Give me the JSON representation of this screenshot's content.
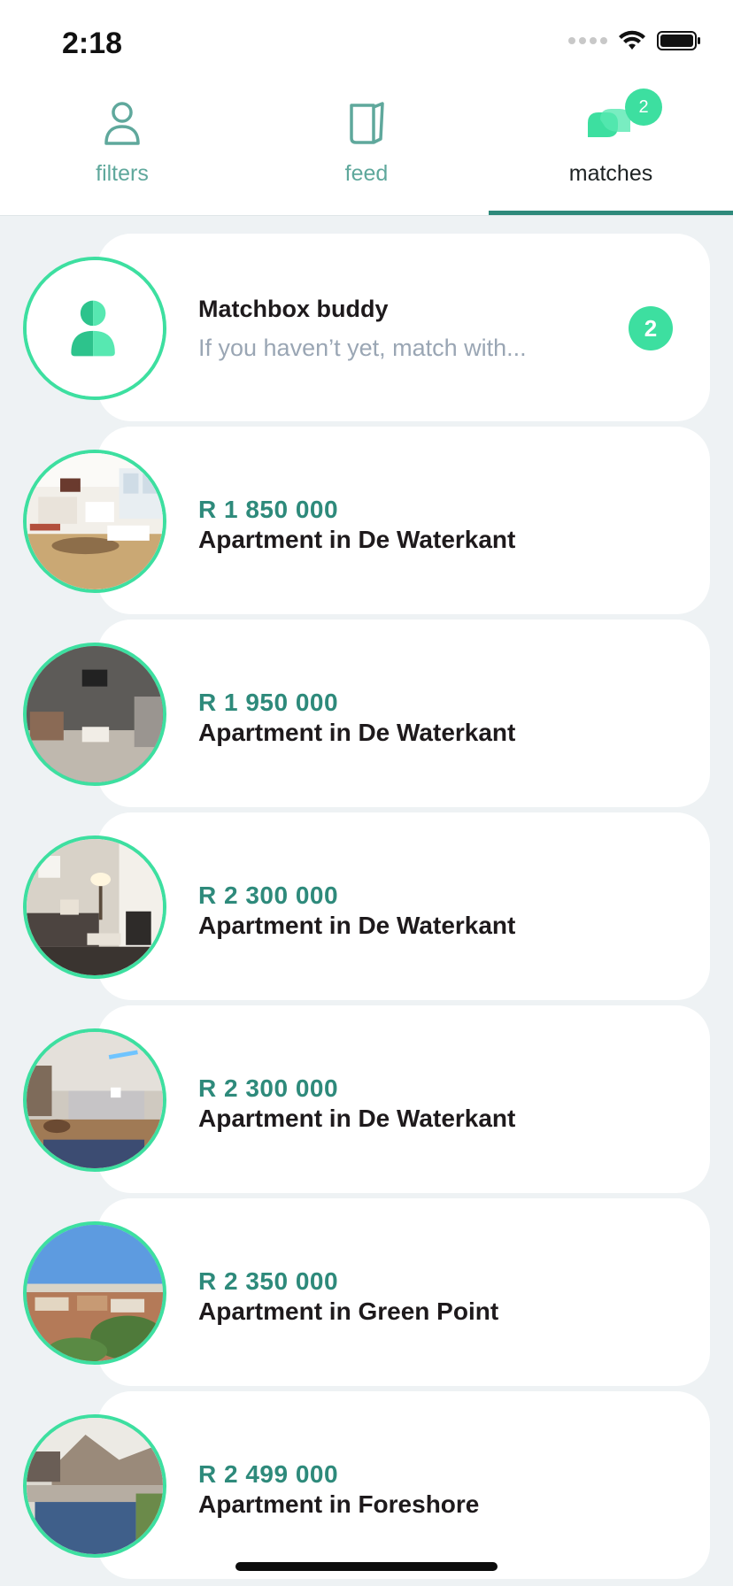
{
  "status": {
    "time": "2:18"
  },
  "tabs": [
    {
      "label": "filters",
      "icon": "user-outline-icon",
      "active": false
    },
    {
      "label": "feed",
      "icon": "card-stack-icon",
      "active": false
    },
    {
      "label": "matches",
      "icon": "chat-bubbles-icon",
      "active": true,
      "badge": "2"
    }
  ],
  "buddy": {
    "title": "Matchbox buddy",
    "subtitle": "If you haven’t yet, match with...",
    "count": "2",
    "icon": "buddy-person-icon"
  },
  "listings": [
    {
      "price": "R 1 850 000",
      "title": "Apartment in De Waterkant",
      "thumb": "open-plan-living-room"
    },
    {
      "price": "R 1 950 000",
      "title": "Apartment in De Waterkant",
      "thumb": "grey-lounge-with-tv"
    },
    {
      "price": "R 2 300 000",
      "title": "Apartment in De Waterkant",
      "thumb": "lounge-with-sofa-and-lamp"
    },
    {
      "price": "R 2 300 000",
      "title": "Apartment in De Waterkant",
      "thumb": "lounge-with-neon-sign"
    },
    {
      "price": "R 2 350 000",
      "title": "Apartment in Green Point",
      "thumb": "aerial-city-view"
    },
    {
      "price": "R 2 499 000",
      "title": "Apartment in Foreshore",
      "thumb": "rooftop-pool-mountain-view"
    }
  ],
  "colors": {
    "accent": "#3ddfa0",
    "price": "#2e8a7b",
    "tab_inactive": "#5fa89c",
    "background": "#eef2f4"
  }
}
